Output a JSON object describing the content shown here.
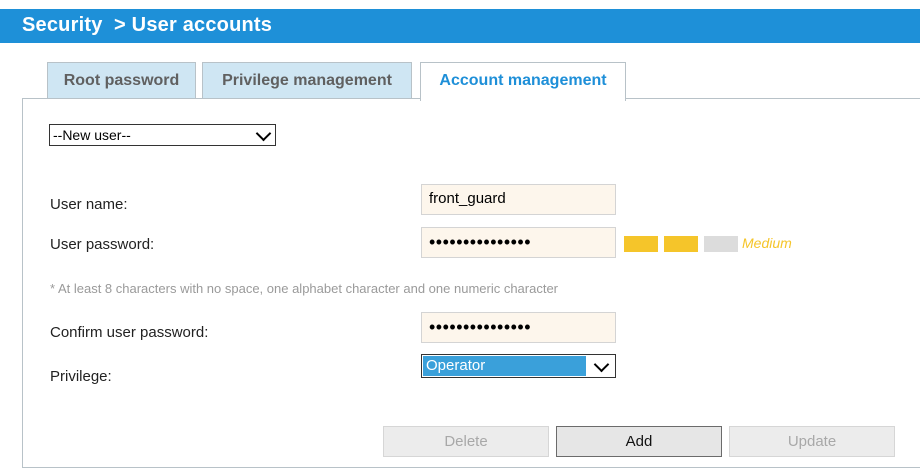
{
  "header": {
    "title": "Security  > User accounts"
  },
  "tabs": [
    {
      "label": "Root password",
      "active": false
    },
    {
      "label": "Privilege management",
      "active": false
    },
    {
      "label": "Account management",
      "active": true
    }
  ],
  "account_select": {
    "value": "--New user--"
  },
  "form": {
    "username_label": "User name:",
    "username_value": "front_guard",
    "password_label": "User password:",
    "password_value": "•••••••••••••••",
    "password_strength": {
      "level_text": "Medium",
      "level": 2,
      "max": 3,
      "colors": [
        "#f5c52a",
        "#f5c52a",
        "#dcdcdc"
      ]
    },
    "hint": "* At least 8 characters with no space, one alphabet character and one numeric character",
    "confirm_label": "Confirm user password:",
    "confirm_value": "•••••••••••••••",
    "privilege_label": "Privilege:",
    "privilege_value": "Operator"
  },
  "buttons": {
    "delete": "Delete",
    "add": "Add",
    "update": "Update"
  },
  "colors": {
    "accent": "#1e90d8",
    "tab_inactive": "#cfe6f3",
    "field_bg": "#fdf6ec",
    "strength": "#f5c52a"
  }
}
